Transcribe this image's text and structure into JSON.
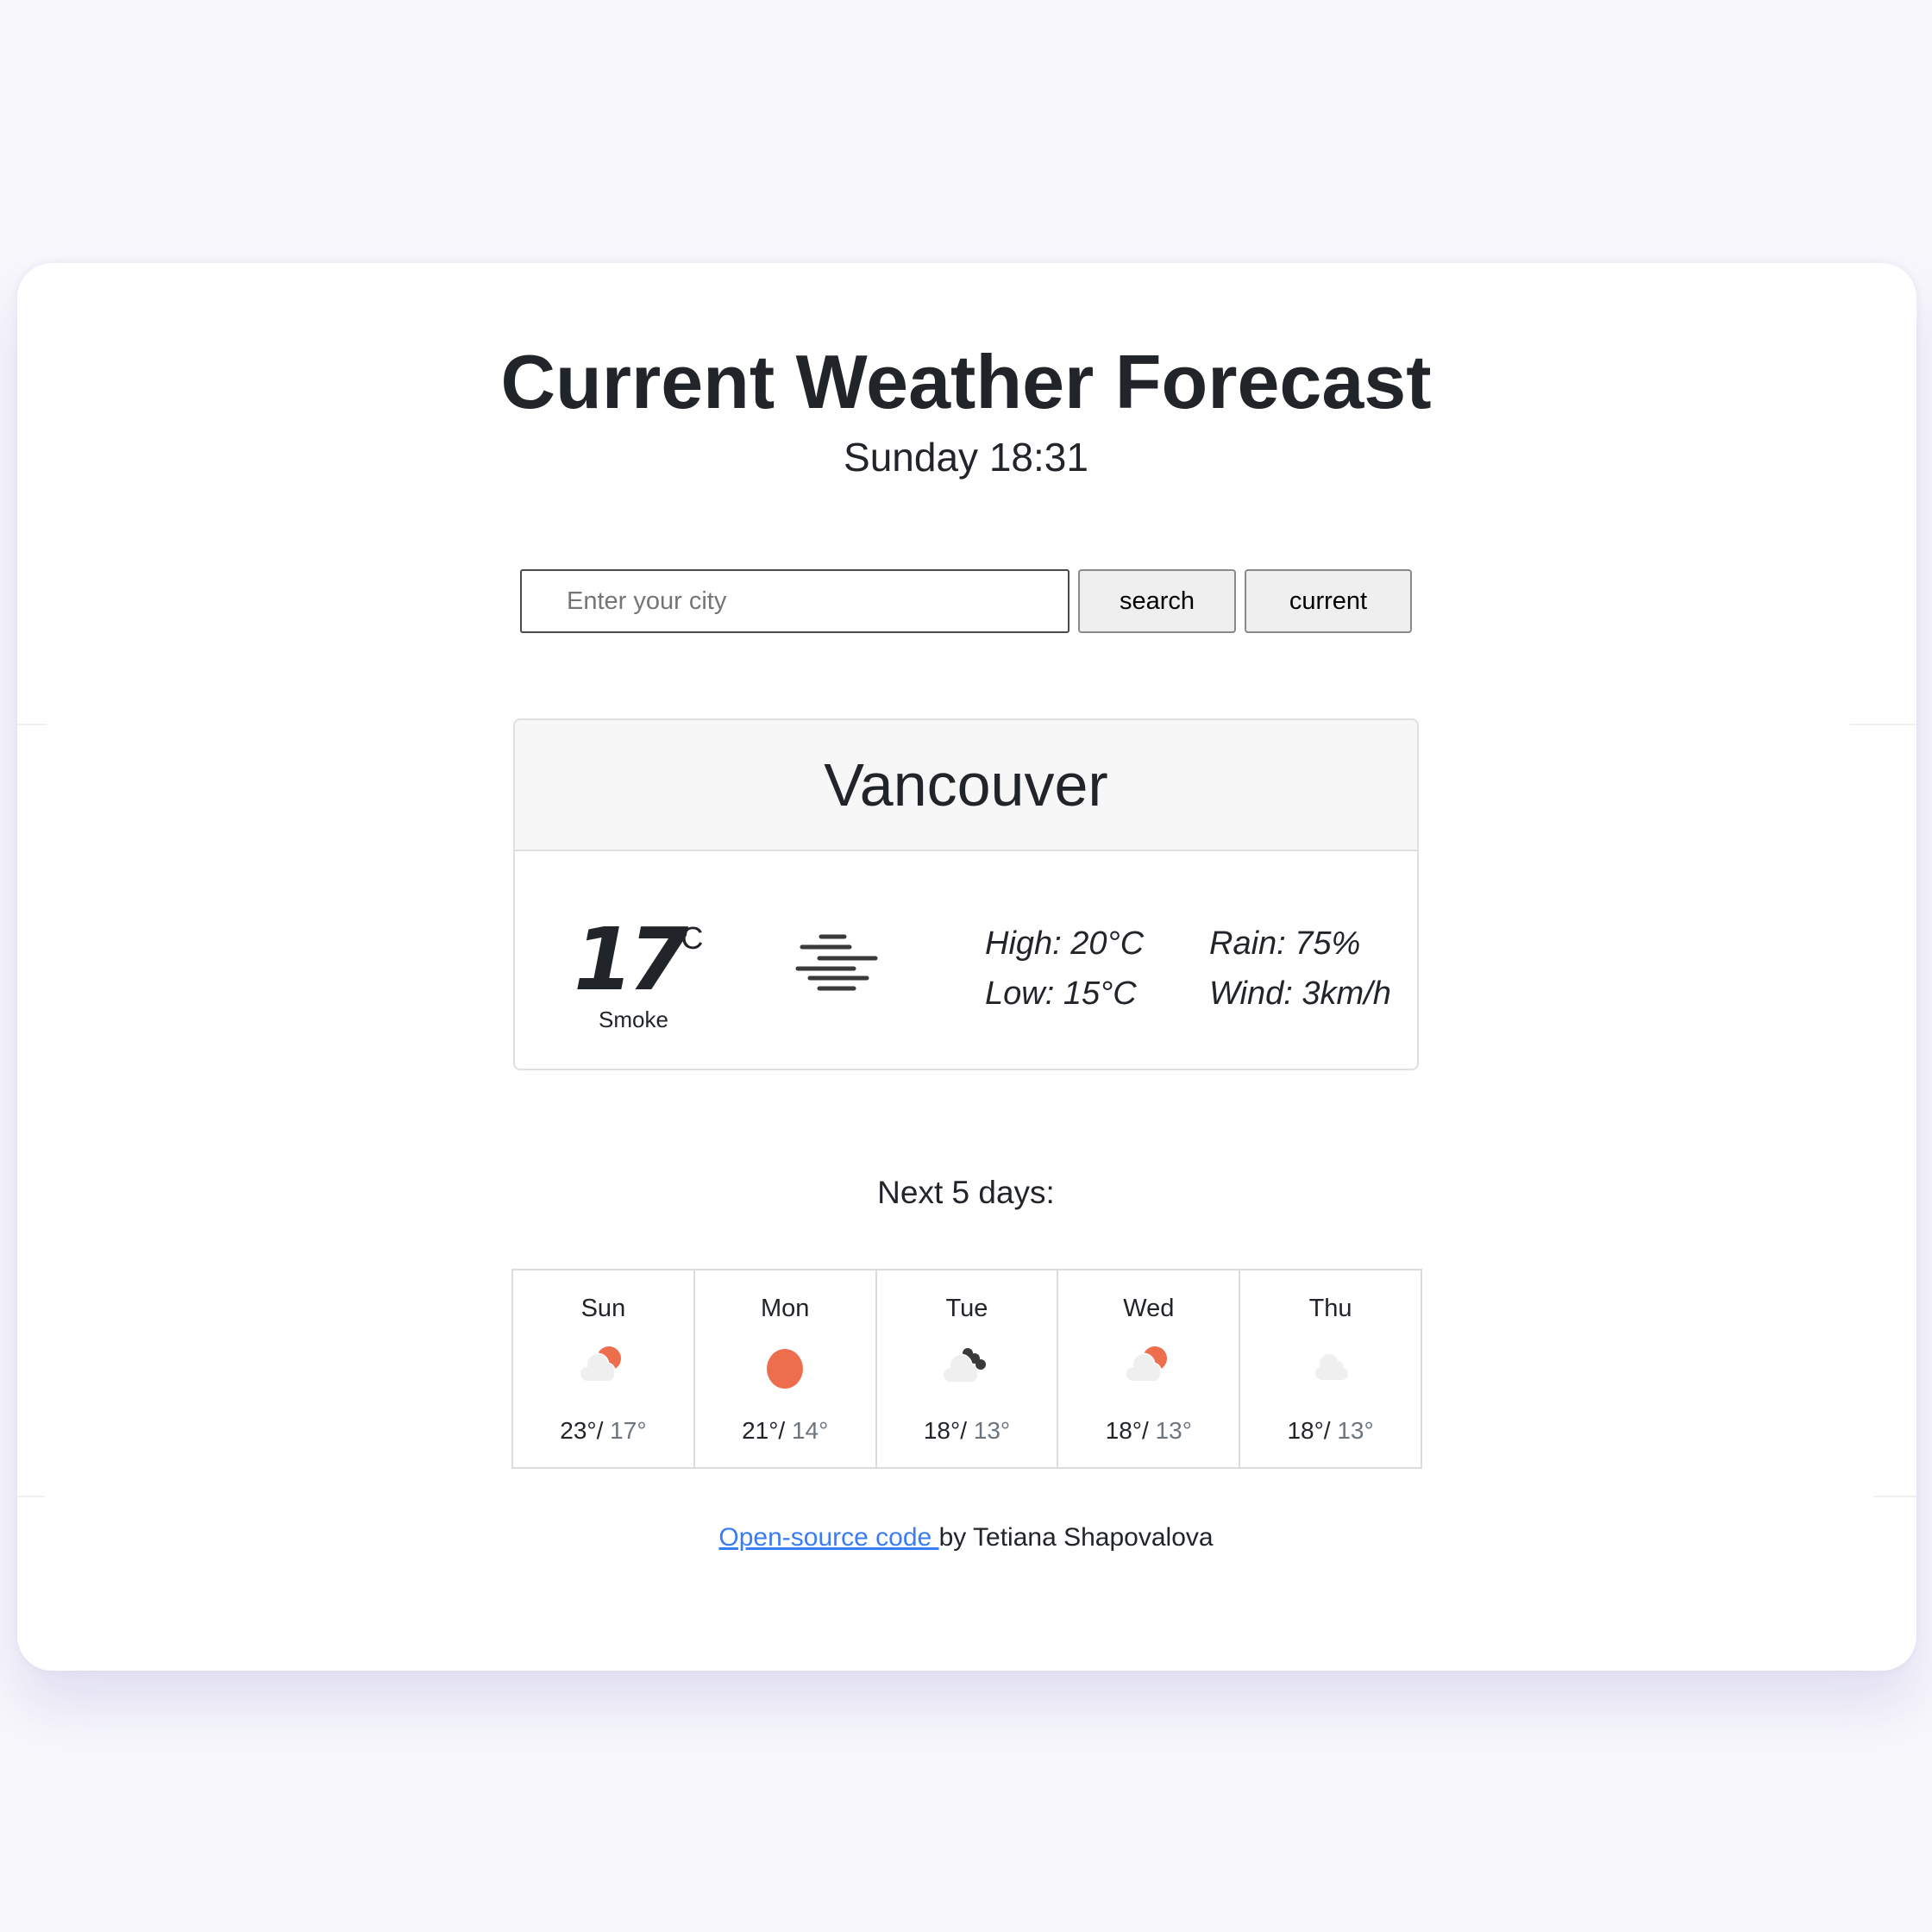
{
  "header": {
    "title": "Current Weather Forecast",
    "datetime": "Sunday 18:31"
  },
  "search": {
    "placeholder": "Enter your city",
    "value": "",
    "search_label": "search",
    "current_label": "current"
  },
  "current": {
    "city": "Vancouver",
    "temperature": "17",
    "unit": "°C",
    "description": "Smoke",
    "icon": "fog-icon",
    "high": "High: 20°C",
    "low": "Low: 15°C",
    "rain": "Rain: 75%",
    "wind": "Wind: 3km/h"
  },
  "forecast": {
    "title": "Next 5 days:",
    "days": [
      {
        "day": "Sun",
        "icon": "partly-cloudy-sun-icon",
        "max": "23°/",
        "min": " 17°"
      },
      {
        "day": "Mon",
        "icon": "sun-icon",
        "max": "21°/",
        "min": " 14°"
      },
      {
        "day": "Tue",
        "icon": "cloud-dark-cloud-icon",
        "max": "18°/",
        "min": " 13°"
      },
      {
        "day": "Wed",
        "icon": "partly-cloudy-sun-icon",
        "max": "18°/",
        "min": " 13°"
      },
      {
        "day": "Thu",
        "icon": "cloud-icon",
        "max": "18°/",
        "min": " 13°"
      }
    ]
  },
  "footer": {
    "link_text": "Open-source code ",
    "author_text": "by Tetiana Shapovalova"
  },
  "colors": {
    "background": "#f7f7fc",
    "sun": "#ec6e4c",
    "cloud": "#efefef",
    "dark_cloud": "#3a3a3a",
    "link": "#3a7cf5"
  }
}
